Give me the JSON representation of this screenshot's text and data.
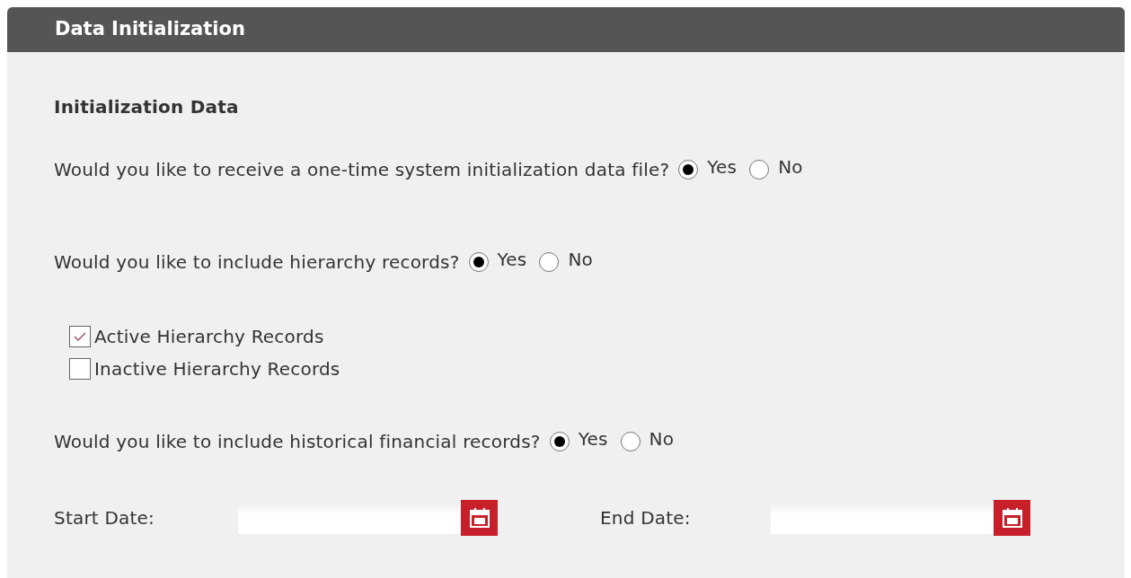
{
  "panel": {
    "title": "Data Initialization"
  },
  "section_title": "Initialization Data",
  "questions": [
    {
      "text": "Would you like to receive a one-time system initialization data file?",
      "options": [
        {
          "label": "Yes",
          "selected": true
        },
        {
          "label": "No",
          "selected": false
        }
      ]
    },
    {
      "text": "Would you like to include hierarchy records?",
      "options": [
        {
          "label": "Yes",
          "selected": true
        },
        {
          "label": "No",
          "selected": false
        }
      ],
      "checkboxes": [
        {
          "label": "Active Hierarchy Records",
          "checked": true
        },
        {
          "label": "Inactive Hierarchy Records",
          "checked": false
        }
      ]
    },
    {
      "text": "Would you like to include historical financial records?",
      "options": [
        {
          "label": "Yes",
          "selected": true
        },
        {
          "label": "No",
          "selected": false
        }
      ]
    }
  ],
  "date_fields": [
    {
      "label": "Start Date:"
    },
    {
      "label": "End Date:"
    }
  ]
}
